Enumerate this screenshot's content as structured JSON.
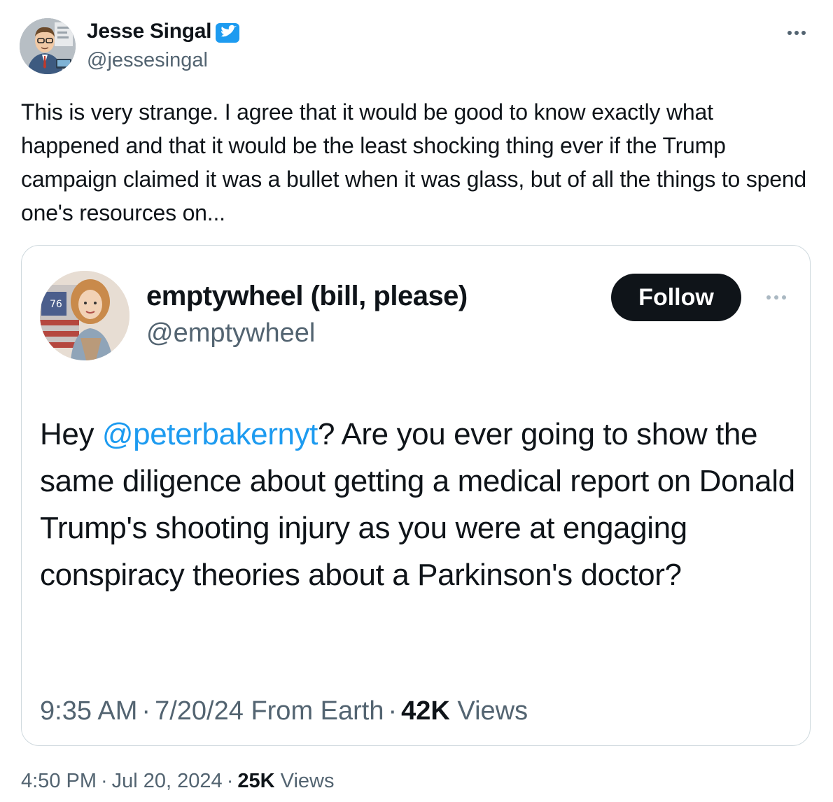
{
  "author": {
    "name": "Jesse Singal",
    "handle": "@jessesingal",
    "verified": true,
    "verified_color": "#1d9bf0",
    "avatar_icon": "cartoon-man-avatar"
  },
  "tweet": {
    "text": "This is very strange. I agree that it would be good to know exactly what happened and that it would be the least shocking thing ever if the Trump campaign claimed it was a bullet when it was glass, but of all the things to spend one's resources on...",
    "time": "4:50 PM",
    "date": "Jul 20, 2024",
    "views_count": "25K",
    "views_label": "Views",
    "separator": "·"
  },
  "quoted_tweet": {
    "author_name": "emptywheel (bill, please)",
    "author_handle": "@emptywheel",
    "avatar_icon": "woman-with-flag-avatar",
    "follow_label": "Follow",
    "text_prefix": "Hey ",
    "mention": "@peterbakernyt",
    "text_suffix": "? Are you ever going to show the same diligence about getting a medical report on Donald Trump's shooting injury as you were at engaging conspiracy theories about a Parkinson's doctor?",
    "time": "9:35 AM",
    "date": "7/20/24",
    "source": "From Earth",
    "views_count": "42K",
    "views_label": "Views",
    "separator": "·"
  },
  "colors": {
    "text": "#0f1419",
    "secondary": "#536471",
    "link": "#1d9bf0",
    "border": "#cfd9de"
  }
}
